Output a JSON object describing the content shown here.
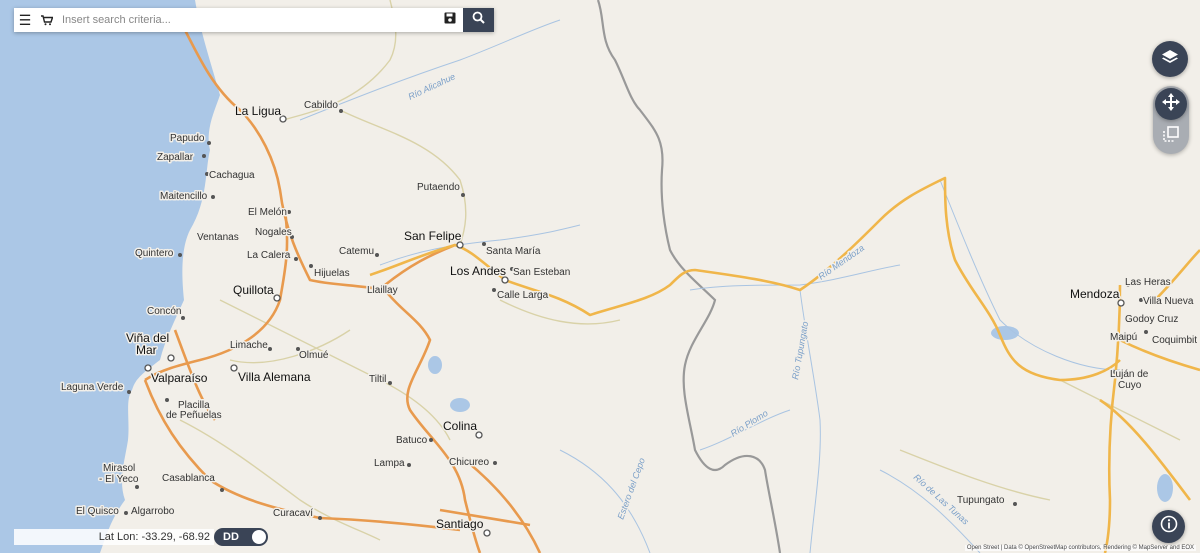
{
  "search": {
    "placeholder": "Insert search criteria..."
  },
  "icons": {
    "menu": "menu-icon",
    "cart": "cart-icon",
    "save": "save-icon",
    "search": "search-icon",
    "layers": "layers-icon",
    "move": "move-icon",
    "select": "select-icon",
    "info": "info-icon"
  },
  "coords": {
    "text": "Lat Lon: -33.29, -68.92"
  },
  "coord_format": {
    "label": "DD"
  },
  "attribution": {
    "text": "Open Street | Data © OpenStreetMap contributors, Rendering © MapServer and EOX"
  },
  "places": {
    "la_ligua": "La Ligua",
    "cabildo": "Cabildo",
    "papudo": "Papudo",
    "zapallar": "Zapallar",
    "cachagua": "Cachagua",
    "maitencillo": "Maitencillo",
    "el_melon": "El Melón",
    "nogales": "Nogales",
    "ventanas": "Ventanas",
    "quintero": "Quintero",
    "la_calera": "La Calera",
    "hijuelas": "Hijuelas",
    "catemu": "Catemu",
    "putaendo": "Putaendo",
    "san_felipe": "San Felipe",
    "santa_maria": "Santa María",
    "los_andes": "Los Andes",
    "san_esteban": "San Esteban",
    "calle_larga": "Calle Larga",
    "llaillay": "Llaillay",
    "quillota": "Quillota",
    "concon": "Concón",
    "vina_del": "Viña del",
    "mar": "Mar",
    "valparaiso": "Valparaíso",
    "limache": "Limache",
    "olmue": "Olmué",
    "villa_alemana": "Villa Alemana",
    "laguna_verde": "Laguna Verde",
    "placilla": "Placilla",
    "de_penuelas": "de Peñuelas",
    "tiltil": "Tiltil",
    "colina": "Colina",
    "batuco": "Batuco",
    "lampa": "Lampa",
    "chicureo": "Chicureo",
    "mirasol": "Mirasol",
    "el_yeco": "- El Yeco",
    "casablanca": "Casablanca",
    "el_quisco": "El Quisco",
    "algarrobo": "Algarrobo",
    "curacavi": "Curacaví",
    "santiago": "Santiago",
    "mendoza": "Mendoza",
    "las_heras": "Las Heras",
    "villa_nueva": "Villa Nueva",
    "godoy_cruz": "Godoy Cruz",
    "maipu": "Maipú",
    "coquimbito": "Coquimbit",
    "lujan": "Luján de",
    "cuyo": "Cuyo",
    "tupungato": "Tupungato"
  },
  "rivers": {
    "alicahue": "Río Alicahue",
    "mendoza": "Río Mendoza",
    "tupungato": "Río Tupungato",
    "plomo": "Río Plomo",
    "estero_del_cepo": "Estero del Cepo",
    "de_las_tunas": "Río de Las Tunas"
  }
}
